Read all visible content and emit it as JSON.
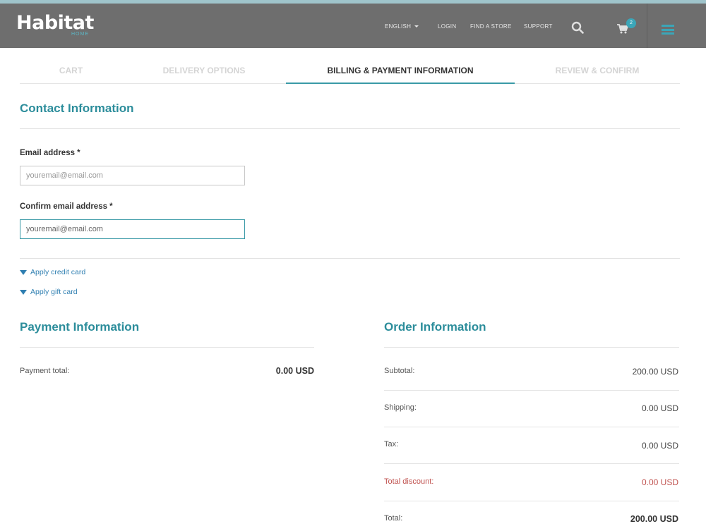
{
  "header": {
    "logo_text": "Habitat",
    "logo_sub": "HOME",
    "nav": {
      "language": "ENGLISH",
      "login": "LOGIN",
      "find_store": "FIND A STORE",
      "support": "SUPPORT"
    },
    "cart_count": "2",
    "icons": [
      "search-icon",
      "cart-icon",
      "menu-icon"
    ],
    "accent_color": "#3ba6b8"
  },
  "steps": [
    {
      "label": "CART",
      "active": false
    },
    {
      "label": "DELIVERY OPTIONS",
      "active": false
    },
    {
      "label": "BILLING & PAYMENT INFORMATION",
      "active": true
    },
    {
      "label": "REVIEW & CONFIRM",
      "active": false
    }
  ],
  "contact": {
    "title": "Contact Information",
    "email_label": "Email address *",
    "email_placeholder": "youremail@email.com",
    "confirm_label": "Confirm email address *",
    "confirm_value": "youremail@email.com"
  },
  "expanders": {
    "credit_card": "Apply credit card",
    "gift_card": "Apply gift card"
  },
  "payment": {
    "title": "Payment Information",
    "total_label": "Payment total:",
    "total_value": "0.00 USD"
  },
  "order": {
    "title": "Order Information",
    "rows": [
      {
        "label": "Subtotal:",
        "value": "200.00 USD"
      },
      {
        "label": "Shipping:",
        "value": "0.00 USD"
      },
      {
        "label": "Tax:",
        "value": "0.00 USD"
      },
      {
        "label": "Total discount:",
        "value": "0.00 USD"
      },
      {
        "label": "Total:",
        "value": "200.00 USD"
      }
    ],
    "discount_color": "#c0524f"
  }
}
